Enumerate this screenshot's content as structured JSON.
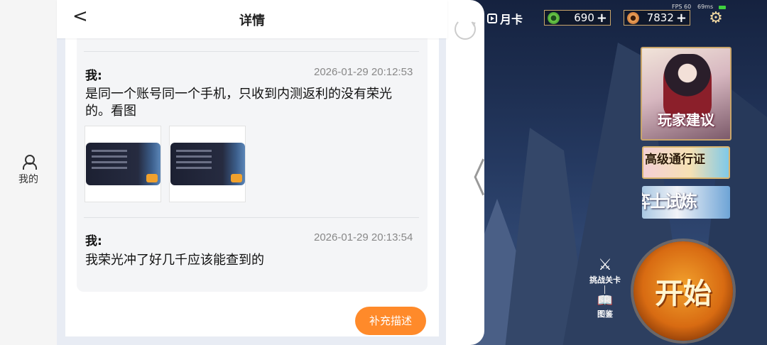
{
  "nav": {
    "my_label": "我的"
  },
  "detail": {
    "title": "详情",
    "back_icon": "chevron-left-icon",
    "messages": [
      {
        "author": "我:",
        "time": "2026-01-29 20:12:53",
        "text": "是同一个账号同一个手机，只收到内测返利的没有荣光的。看图",
        "image_count": 2
      },
      {
        "author": "我:",
        "time": "2026-01-29 20:13:54",
        "text": "我荣光冲了好几千应该能查到的"
      }
    ],
    "supplement_button": "补充描述"
  },
  "game": {
    "month_card": "月卡",
    "jade_amount": "690",
    "gold_amount": "7832",
    "fps": "FPS 60",
    "latency": "69ms",
    "banners": {
      "suggestion": "玩家建议",
      "pass": "高级通行证",
      "trial": "弈士试炼"
    },
    "challenge_label": "挑战关卡",
    "atlas_label": "图鉴",
    "start_button": "开始"
  },
  "colors": {
    "accent_orange": "#ff8a2a",
    "card_bg": "#f4f5f7",
    "time_gray": "#888888"
  }
}
